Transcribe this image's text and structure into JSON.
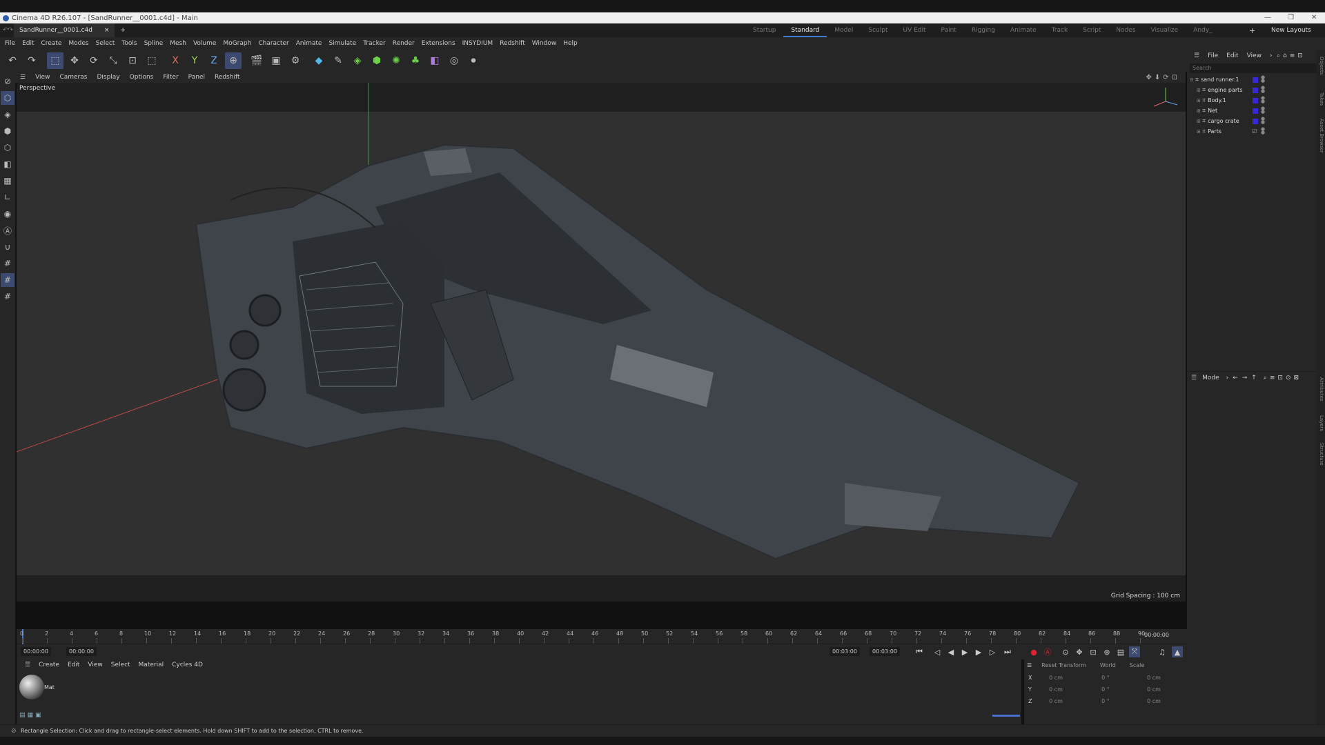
{
  "window": {
    "title": "Cinema 4D R26.107 - [SandRunner__0001.c4d] - Main"
  },
  "tabs": [
    {
      "label": "SandRunner__0001.c4d",
      "close": "×"
    }
  ],
  "new_tab": "+",
  "layouts": [
    "Startup",
    "Standard",
    "Model",
    "Sculpt",
    "UV Edit",
    "Paint",
    "Rigging",
    "Animate",
    "Track",
    "Script",
    "Nodes",
    "Visualize",
    "Andy_"
  ],
  "active_layout": "Standard",
  "new_layouts": "New Layouts",
  "menus": [
    "File",
    "Edit",
    "Create",
    "Modes",
    "Select",
    "Tools",
    "Spline",
    "Mesh",
    "Volume",
    "MoGraph",
    "Character",
    "Animate",
    "Simulate",
    "Tracker",
    "Render",
    "Extensions",
    "INSYDIUM",
    "Redshift",
    "Window",
    "Help"
  ],
  "axis_labels": {
    "x": "X",
    "y": "Y",
    "z": "Z"
  },
  "viewport": {
    "menus": [
      "View",
      "Cameras",
      "Display",
      "Options",
      "Filter",
      "Panel",
      "Redshift"
    ],
    "camera_label": "Perspective",
    "grid_spacing": "Grid Spacing : 100 cm"
  },
  "objects_panel": {
    "menus": [
      "File",
      "Edit",
      "View"
    ],
    "search_placeholder": "Search",
    "items": [
      {
        "name": "sand runner.1"
      },
      {
        "name": "engine parts"
      },
      {
        "name": "Body.1"
      },
      {
        "name": "Net"
      },
      {
        "name": "cargo crate"
      },
      {
        "name": "Parts"
      }
    ]
  },
  "attributes_panel": {
    "mode_label": "Mode"
  },
  "side_tabs": [
    "Objects",
    "Takes",
    "Asset Browser",
    "Attributes",
    "Layers",
    "Structure"
  ],
  "timeline": {
    "ticks": [
      "0",
      "2",
      "4",
      "6",
      "8",
      "10",
      "12",
      "14",
      "16",
      "18",
      "20",
      "22",
      "24",
      "26",
      "28",
      "30",
      "32",
      "34",
      "36",
      "38",
      "40",
      "42",
      "44",
      "46",
      "48",
      "50",
      "52",
      "54",
      "56",
      "58",
      "60",
      "62",
      "64",
      "66",
      "68",
      "70",
      "72",
      "74",
      "76",
      "78",
      "80",
      "82",
      "84",
      "86",
      "88",
      "90"
    ],
    "current_time": "00:00:00",
    "start_time": "00:00:00",
    "preview_start": "00:00:00",
    "preview_end": "00:03:00",
    "end_time": "00:03:00",
    "right_time": "00:00:00"
  },
  "material_manager": {
    "menus": [
      "Create",
      "Edit",
      "View",
      "Select",
      "Material",
      "Cycles 4D"
    ],
    "materials": [
      {
        "name": "Mat"
      }
    ]
  },
  "coordinates": {
    "mode": "Reset Transform",
    "space": "World",
    "scale": "Scale",
    "rows": [
      {
        "axis": "X",
        "pos": "0 cm",
        "rot": "0 °",
        "size": "0 cm"
      },
      {
        "axis": "Y",
        "pos": "0 cm",
        "rot": "0 °",
        "size": "0 cm"
      },
      {
        "axis": "Z",
        "pos": "0 cm",
        "rot": "0 °",
        "size": "0 cm"
      }
    ]
  },
  "status": {
    "text": "Rectangle Selection: Click and drag to rectangle-select elements. Hold down SHIFT to add to the selection, CTRL to remove."
  }
}
